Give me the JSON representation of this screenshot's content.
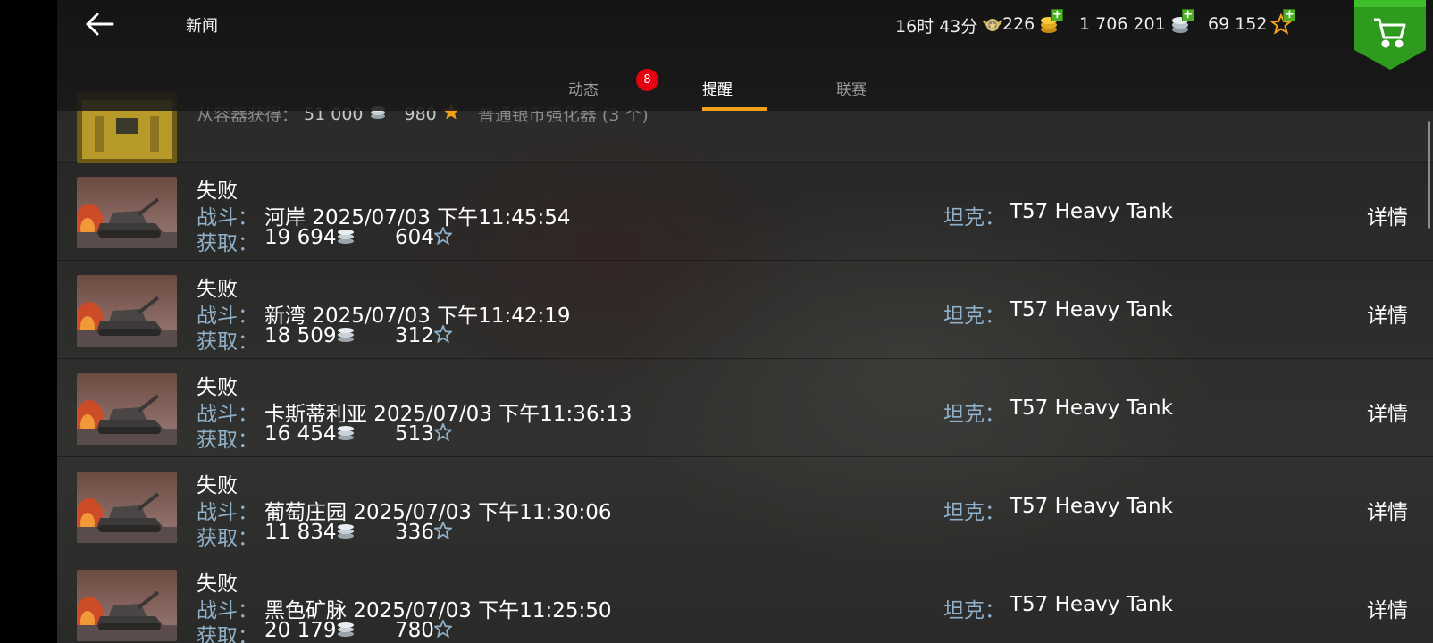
{
  "header": {
    "back_icon": "arrow-left-icon",
    "title": "新闻",
    "timer": "16时 43分",
    "gold": "226",
    "silver": "1 706 201",
    "free_xp": "69 152",
    "shop_icon": "shopping-cart-icon"
  },
  "tabs": [
    {
      "label": "动态",
      "badge": "8"
    },
    {
      "label": "提醒",
      "active": true
    },
    {
      "label": "联赛"
    }
  ],
  "partial_row": {
    "label": "从容器获得：",
    "silver": "51 000",
    "xp": "980",
    "item": "普通银币强化器 (3 个)"
  },
  "labels": {
    "battle": "战斗：",
    "earned": "获取：",
    "tank": "坦克：",
    "details": "详情"
  },
  "rows": [
    {
      "result": "失败",
      "battle": "河岸 2025/07/03 下午11:45:54",
      "silver": "19 694",
      "xp": "604",
      "tank": "T57 Heavy Tank"
    },
    {
      "result": "失败",
      "battle": "新湾 2025/07/03 下午11:42:19",
      "silver": "18 509",
      "xp": "312",
      "tank": "T57 Heavy Tank"
    },
    {
      "result": "失败",
      "battle": "卡斯蒂利亚 2025/07/03 下午11:36:13",
      "silver": "16 454",
      "xp": "513",
      "tank": "T57 Heavy Tank"
    },
    {
      "result": "失败",
      "battle": "葡萄庄园 2025/07/03 下午11:30:06",
      "silver": "11 834",
      "xp": "336",
      "tank": "T57 Heavy Tank"
    },
    {
      "result": "失败",
      "battle": "黑色矿脉 2025/07/03 下午11:25:50",
      "silver": "20 179",
      "xp": "780",
      "tank": "T57 Heavy Tank"
    }
  ],
  "colors": {
    "accent": "#f2a21a",
    "label_blue": "#8fb0c8",
    "badge_red": "#e60012",
    "shop_green": "#2e9b1f"
  }
}
